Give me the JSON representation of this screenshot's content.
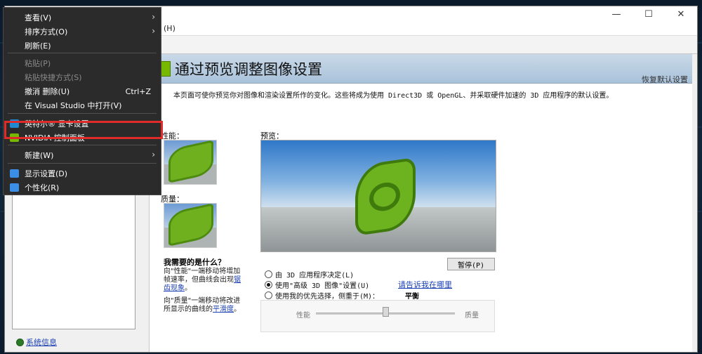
{
  "window": {
    "menu_help": "(H)",
    "controls": {
      "minimize": "—",
      "maximize": "☐",
      "close": "✕"
    }
  },
  "context_menu": {
    "items": [
      {
        "label": "查看(V)",
        "submenu": true
      },
      {
        "label": "排序方式(O)",
        "submenu": true
      },
      {
        "label": "刷新(E)"
      },
      {
        "label": "粘贴(P)",
        "disabled": true
      },
      {
        "label": "粘贴快捷方式(S)",
        "disabled": true
      },
      {
        "label": "撤消 删除(U)",
        "shortcut": "Ctrl+Z"
      },
      {
        "label": "在 Visual Studio 中打开(V)"
      },
      {
        "label": "英特尔® 显卡设置",
        "icon": "intel-graphics-icon"
      },
      {
        "label": "NVIDIA 控制面板",
        "icon": "nvidia-icon",
        "highlighted": true
      },
      {
        "label": "新建(W)",
        "submenu": true
      },
      {
        "label": "显示设置(D)",
        "icon": "display-icon"
      },
      {
        "label": "个性化(R)",
        "icon": "personalize-icon"
      }
    ],
    "highlight_color": "#e02b2b"
  },
  "page": {
    "title": "通过预览调整图像设置",
    "restore_defaults": "恢复默认设置",
    "description": "本页面可使你预览你对图像和渲染设置所作的变化。这些将成为使用 Direct3D 或 OpenGL、并采取硬件加速的 3D 应用程序的默认设置。",
    "performance_label": "性能：",
    "quality_label": "质量：",
    "preview_label": "预览：",
    "help_title": "我需要的是什么？",
    "help_perf_text": "向\"性能\"一端移动将增加帧速率，但曲线会出现",
    "help_perf_link": "锯齿现象",
    "help_perf_end": "。",
    "help_qual_text": "向\"质量\"一端移动将改进所显示的曲线的",
    "help_qual_link": "平滑度",
    "help_qual_end": "。",
    "pause_button": "暂停(P)",
    "options": [
      {
        "label": "由 3D 应用程序决定(L)",
        "selected": false
      },
      {
        "label": "使用\"高级 3D 图像\"设置(U)",
        "selected": true
      },
      {
        "label": "使用我的优先选择，侧重于(M)：",
        "selected": false
      }
    ],
    "tell_me_link": "请告诉我在哪里",
    "balance_label": "平衡",
    "slider_left": "性能",
    "slider_right": "质量",
    "slider_position": 0.5,
    "accent_color": "#76b900"
  },
  "left_pane": {
    "system_info": "系统信息"
  }
}
